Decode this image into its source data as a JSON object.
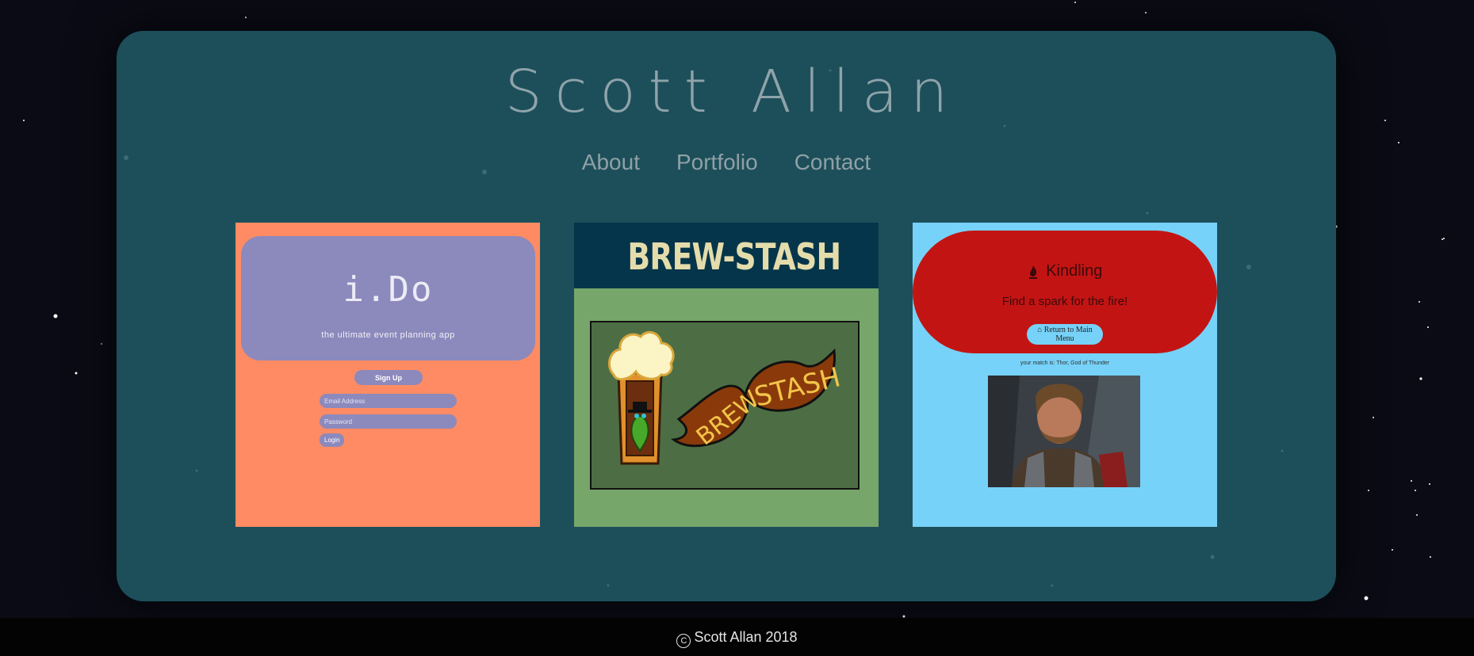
{
  "site": {
    "title": "Scott Allan",
    "nav": [
      {
        "label": "About"
      },
      {
        "label": "Portfolio"
      },
      {
        "label": "Contact"
      }
    ]
  },
  "portfolio": {
    "ido": {
      "title": "i.Do",
      "subtitle": "the ultimate event planning app",
      "signup_label": "Sign Up",
      "email_placeholder": "Email Address",
      "password_placeholder": "Password",
      "login_label": "Login"
    },
    "brew": {
      "title": "BREW-STASH",
      "logo_word_1": "BREW",
      "logo_word_2": "STASH"
    },
    "kindling": {
      "icon": "fire-icon",
      "title": "Kindling",
      "tagline": "Find a spark for the fire!",
      "button_label": "Return to Main Menu",
      "button_icon": "home-icon",
      "match_text": "your match is: Thor, God of Thunder"
    }
  },
  "footer": {
    "icon": "copyright-icon",
    "text": "Scott Allan 2018"
  },
  "colors": {
    "background": "#0a0b14",
    "panel": "#1d4f5a",
    "ido_card": "#fe8b63",
    "ido_accent": "#8c89bd",
    "brew_card": "#76a66a",
    "brew_header": "#05354a",
    "kindling_card": "#76d2f8",
    "kindling_hero": "#c31414"
  }
}
